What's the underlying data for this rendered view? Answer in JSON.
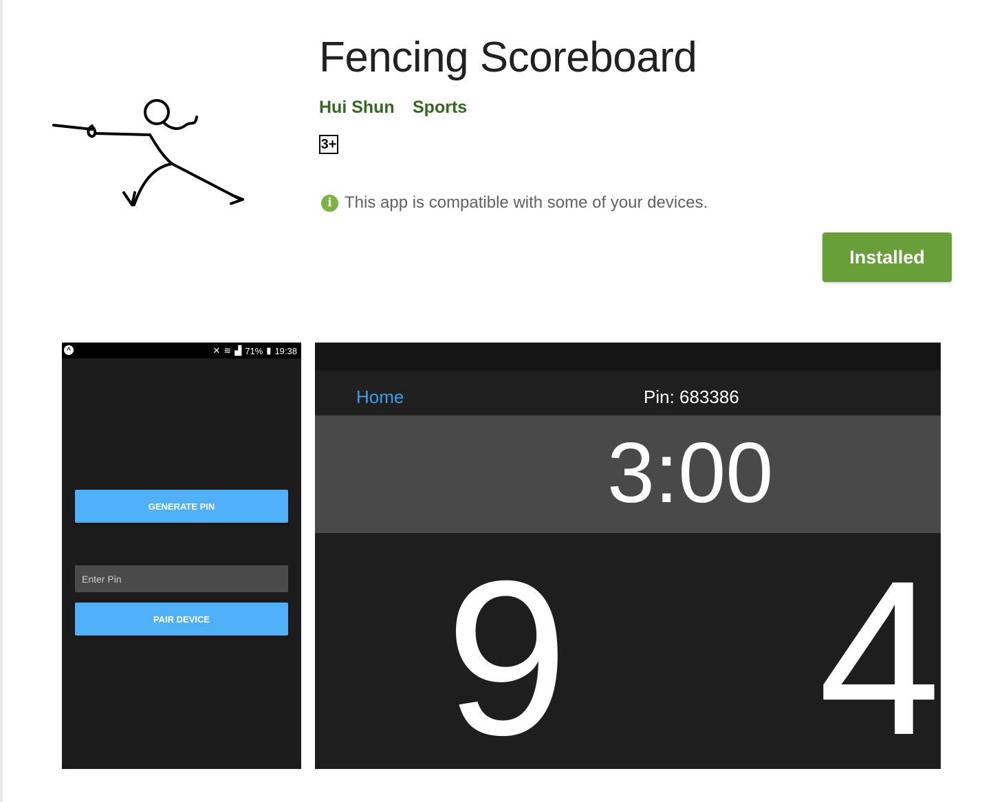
{
  "app": {
    "title": "Fencing Scoreboard",
    "developer": "Hui Shun",
    "category": "Sports",
    "rating": "3+",
    "compatibility": "This app is compatible with some of your devices.",
    "install_label": "Installed",
    "icon_name": "fencer-logo",
    "colors": {
      "link": "#33691e",
      "button": "#689f38",
      "info": "#7cb342"
    }
  },
  "screenshot1": {
    "status": {
      "battery": "71%",
      "time": "19:38"
    },
    "generate_label": "GENERATE PIN",
    "pin_placeholder": "Enter Pin",
    "pair_label": "PAIR DEVICE",
    "button_color": "#4fb0f8"
  },
  "screenshot2": {
    "home_label": "Home",
    "pin_text": "Pin: 683386",
    "timer": "3:00",
    "score_left": "9",
    "score_right": "4",
    "link_color": "#3d9ee8"
  }
}
